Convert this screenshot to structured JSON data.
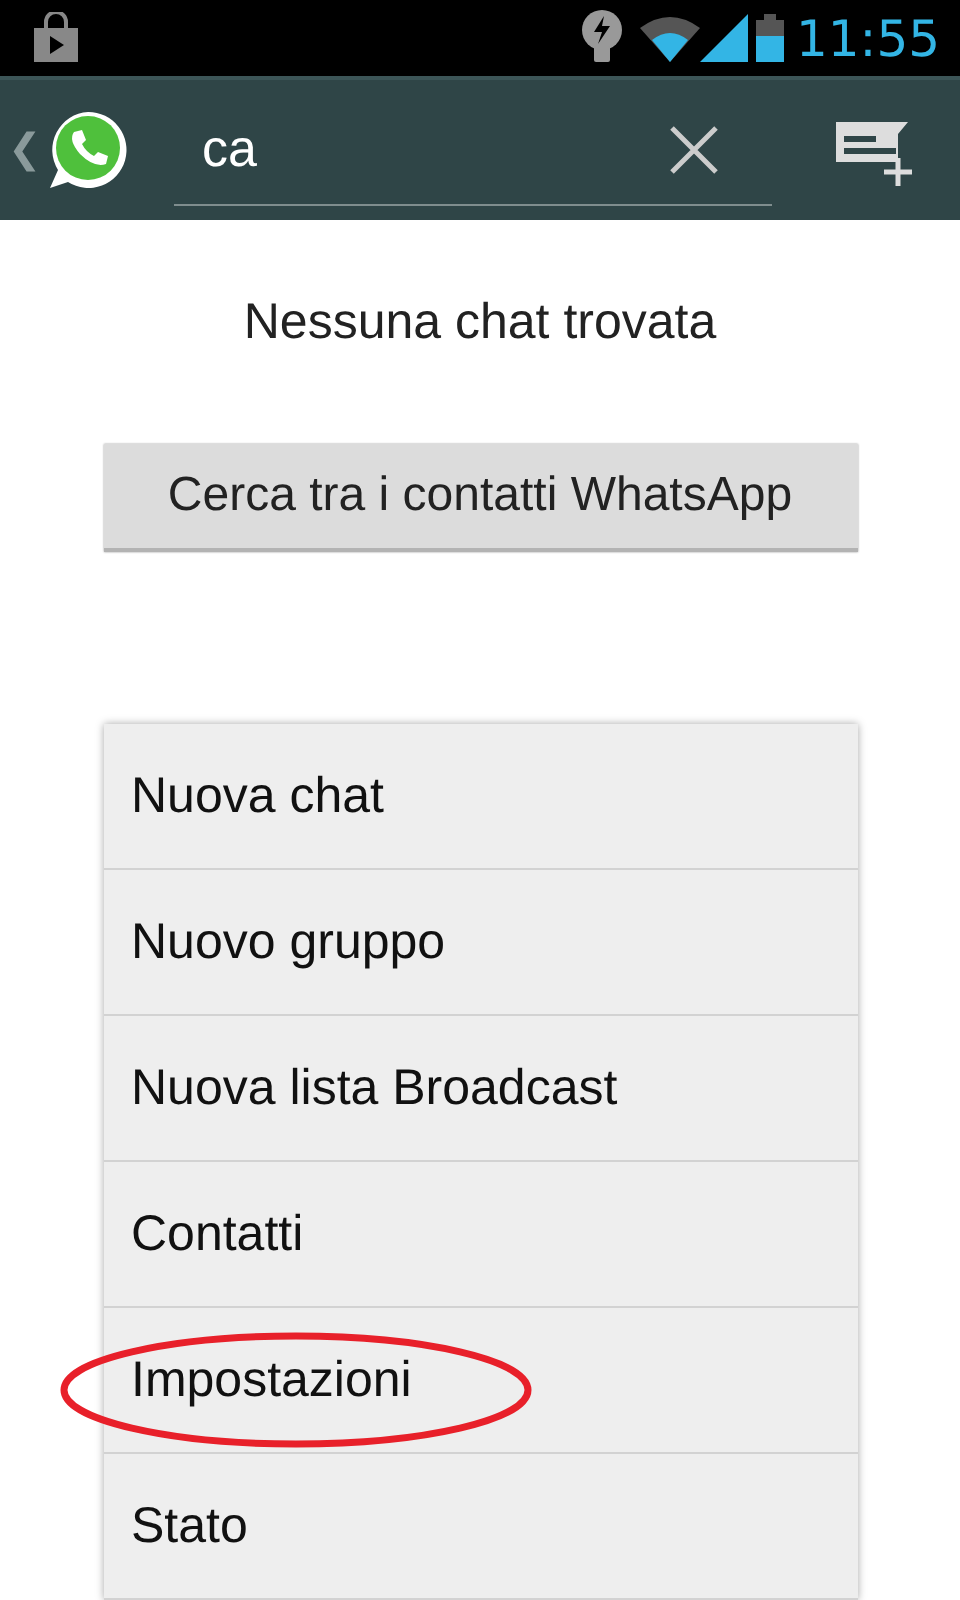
{
  "status_bar": {
    "time": "11:55"
  },
  "app_bar": {
    "back": "❮",
    "search": {
      "value": "ca"
    }
  },
  "empty_message": "Nessuna chat trovata",
  "search_contacts_button": "Cerca tra i contatti WhatsApp",
  "menu": [
    {
      "label": "Nuova chat",
      "circled": false
    },
    {
      "label": "Nuovo gruppo",
      "circled": false
    },
    {
      "label": "Nuova lista Broadcast",
      "circled": false
    },
    {
      "label": "Contatti",
      "circled": false
    },
    {
      "label": "Impostazioni",
      "circled": true
    },
    {
      "label": "Stato",
      "circled": false
    }
  ]
}
